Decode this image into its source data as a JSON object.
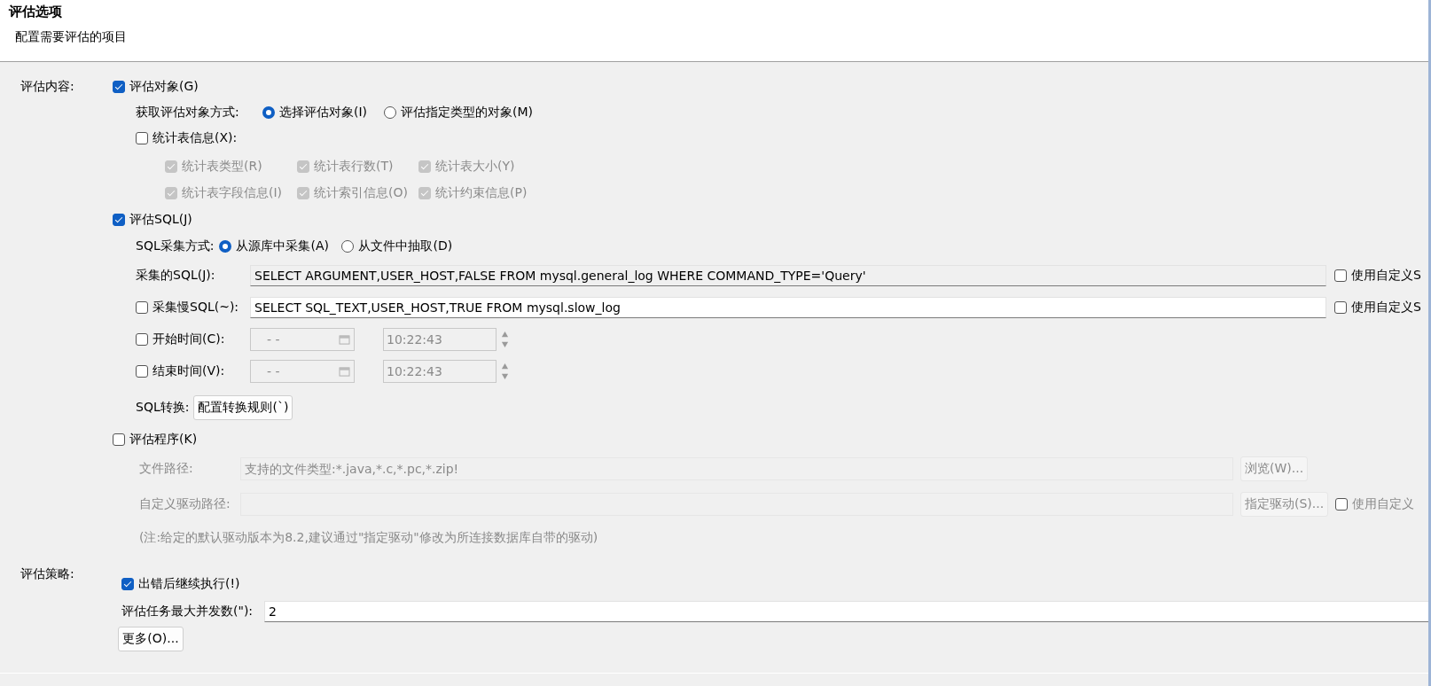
{
  "header": {
    "title": "评估选项",
    "subtitle": "配置需要评估的项目"
  },
  "content_label": "评估内容:",
  "objects": {
    "label": "评估对象(G)",
    "checked": true,
    "method_label": "获取评估对象方式:",
    "methods": [
      {
        "label": "选择评估对象(I)",
        "selected": true
      },
      {
        "label": "评估指定类型的对象(M)",
        "selected": false
      }
    ],
    "stats": {
      "label": "统计表信息(X):",
      "checked": false,
      "items": [
        {
          "label": "统计表类型(R)",
          "checked": true,
          "disabled": true
        },
        {
          "label": "统计表行数(T)",
          "checked": true,
          "disabled": true
        },
        {
          "label": "统计表大小(Y)",
          "checked": true,
          "disabled": true
        },
        {
          "label": "统计表字段信息(I)",
          "checked": true,
          "disabled": true
        },
        {
          "label": "统计索引信息(O)",
          "checked": true,
          "disabled": true
        },
        {
          "label": "统计约束信息(P)",
          "checked": true,
          "disabled": true
        }
      ]
    }
  },
  "sql": {
    "label": "评估SQL(J)",
    "checked": true,
    "method_label": "SQL采集方式:",
    "methods": [
      {
        "label": "从源库中采集(A)",
        "selected": true
      },
      {
        "label": "从文件中抽取(D)",
        "selected": false
      }
    ],
    "rows": [
      {
        "kind": "query",
        "label": "采集的SQL(J):",
        "value": "SELECT ARGUMENT,USER_HOST,FALSE FROM mysql.general_log WHERE COMMAND_TYPE='Query'",
        "disabled": true,
        "custom": {
          "label": "使用自定义S",
          "checked": false
        }
      },
      {
        "kind": "query",
        "label": "采集慢SQL(~):",
        "checked": false,
        "value": "SELECT SQL_TEXT,USER_HOST,TRUE FROM mysql.slow_log",
        "disabled": false,
        "custom": {
          "label": "使用自定义S",
          "checked": false
        }
      },
      {
        "kind": "time",
        "label": "开始时间(C):",
        "checked": false,
        "date": "-  -",
        "time": "10:22:43"
      },
      {
        "kind": "time",
        "label": "结束时间(V):",
        "checked": false,
        "date": "-  -",
        "time": "10:22:43"
      },
      {
        "kind": "button",
        "label": "SQL转换:",
        "button": "配置转换规则(`)"
      }
    ]
  },
  "program": {
    "label": "评估程序(K)",
    "checked": false,
    "disabled": true,
    "rows": [
      {
        "label": "文件路径:",
        "placeholder": "支持的文件类型:*.java,*.c,*.pc,*.zip!",
        "button": "浏览(W)..."
      },
      {
        "label": "自定义驱动路径:",
        "button": "指定驱动(S)...",
        "custom": {
          "label": "使用自定义",
          "checked": false
        }
      }
    ],
    "note": "(注:给定的默认驱动版本为8.2,建议通过\"指定驱动\"修改为所连接数据库自带的驱动)"
  },
  "strategy": {
    "label": "评估策略:",
    "continue": {
      "label": "出错后继续执行(!)",
      "checked": true
    },
    "concurrency": {
      "label": "评估任务最大并发数(\"):",
      "value": "2"
    },
    "more_button": "更多(O)..."
  }
}
